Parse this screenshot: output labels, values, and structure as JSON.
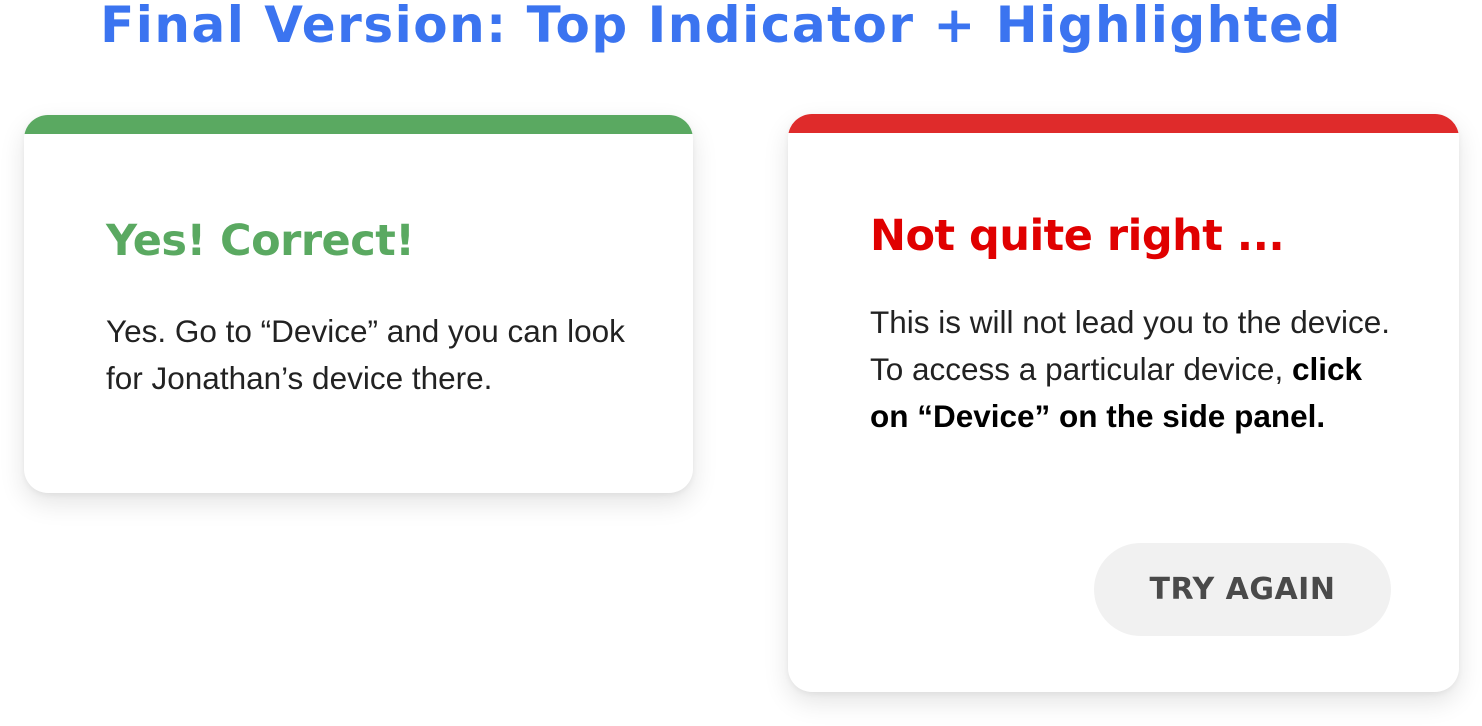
{
  "title": "Final Version: Top Indicator + Highlighted",
  "colors": {
    "title": "#3b74f0",
    "correct_accent": "#5aa961",
    "wrong_accent": "#df2b2b",
    "wrong_heading": "#e00000",
    "button_bg": "#f1f1f1",
    "button_text": "#4a4a4a"
  },
  "correct_card": {
    "indicator": "success",
    "heading": "Yes! Correct!",
    "body": "Yes. Go to “Device” and you can look for Jonathan’s device there."
  },
  "wrong_card": {
    "indicator": "error",
    "heading": "Not quite right ...",
    "body_plain": "This is will not lead you to the device. To access a particular device, ",
    "body_bold": "click on “Device” on the side panel.",
    "button_label": "TRY AGAIN"
  }
}
